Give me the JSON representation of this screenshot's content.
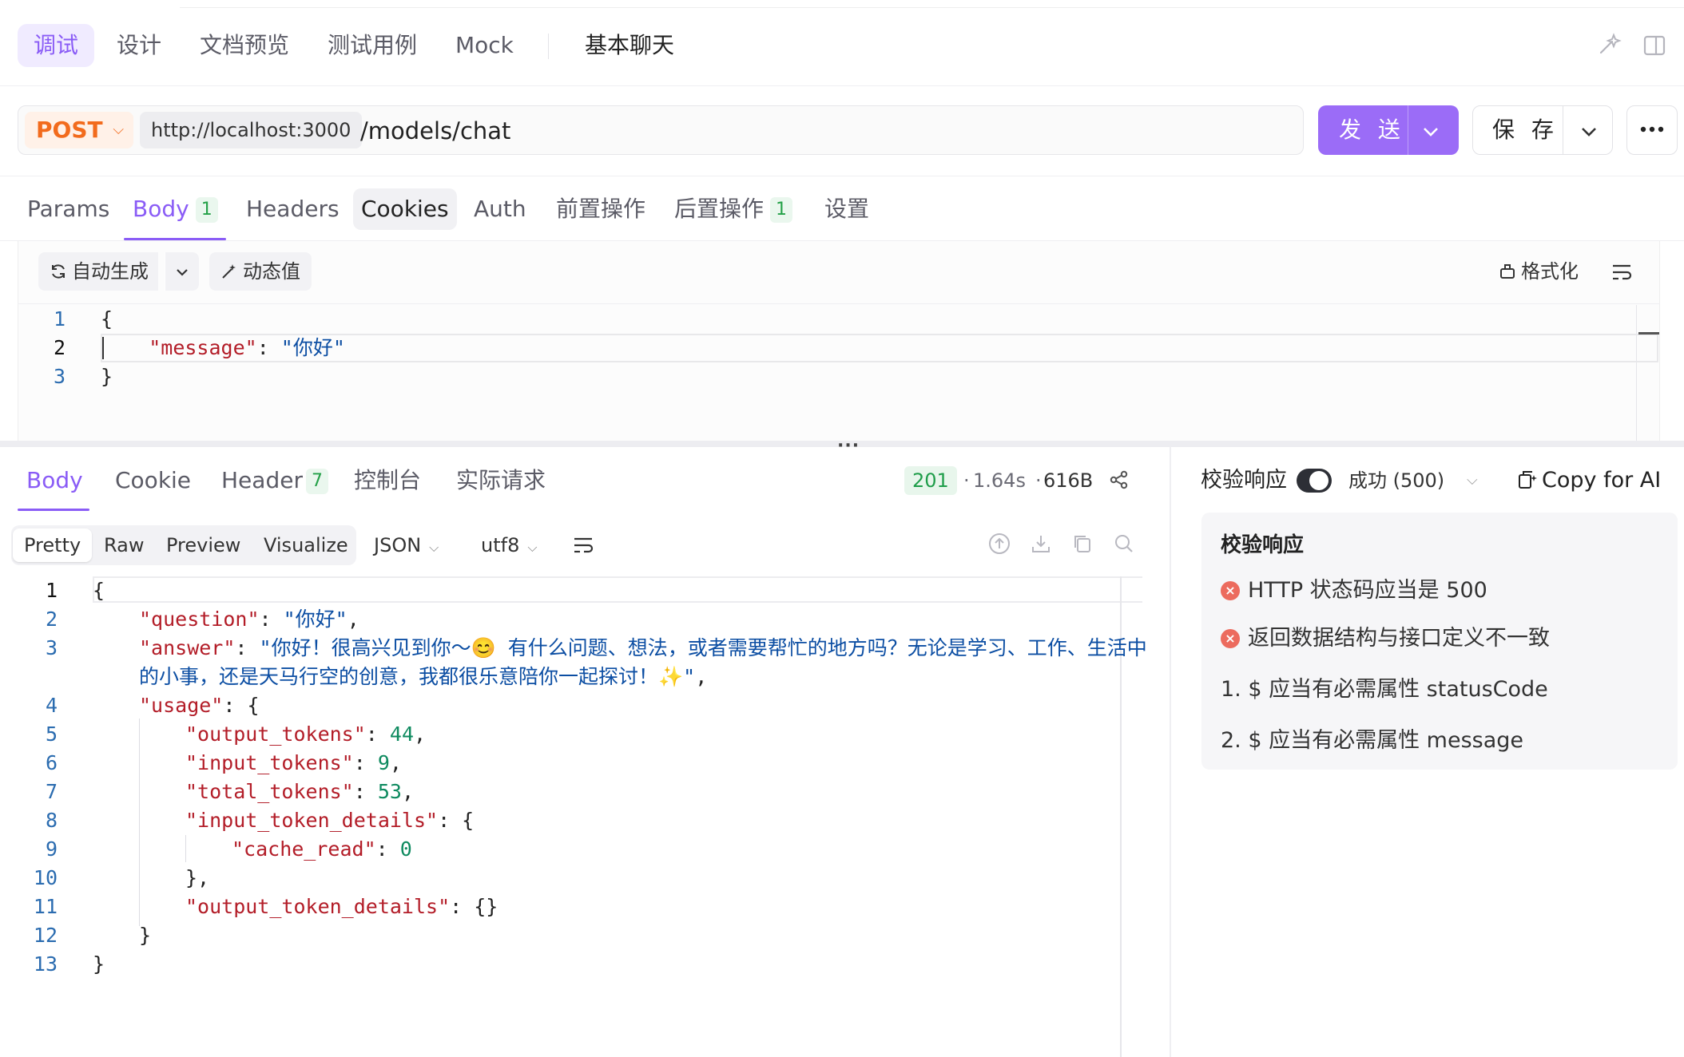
{
  "top_tabs": [
    "调试",
    "设计",
    "文档预览",
    "测试用例",
    "Mock"
  ],
  "api_name": "基本聊天",
  "request": {
    "method": "POST",
    "host": "http://localhost:3000",
    "path": "/models/chat",
    "send_label": "发 送",
    "save_label": "保 存"
  },
  "request_tabs": {
    "params": "Params",
    "body": "Body",
    "body_badge": "1",
    "headers": "Headers",
    "cookies": "Cookies",
    "auth": "Auth",
    "pre": "前置操作",
    "post": "后置操作",
    "post_badge": "1",
    "settings": "设置"
  },
  "body_toolbar": {
    "auto_generate": "自动生成",
    "dynamic_value": "动态值",
    "format": "格式化"
  },
  "request_body_lines": [
    {
      "n": "1",
      "t": "{"
    },
    {
      "n": "2",
      "t": "    \"message\": \"你好\""
    },
    {
      "n": "3",
      "t": "}"
    }
  ],
  "response_tabs": {
    "body": "Body",
    "cookie": "Cookie",
    "header": "Header",
    "header_badge": "7",
    "console": "控制台",
    "actual": "实际请求"
  },
  "response_meta": {
    "status": "201",
    "time": "1.64s",
    "size": "616B"
  },
  "view_tabs": [
    "Pretty",
    "Raw",
    "Preview",
    "Visualize"
  ],
  "format_select": "JSON",
  "encoding_select": "utf8",
  "response_body": {
    "l1": "{",
    "question_key": "\"question\"",
    "question_val": "\"你好\"",
    "answer_key": "\"answer\"",
    "answer_val_1": "\"你好！很高兴见到你～😊 有什么问题、想法，或者需要帮忙的地方吗？无论是学习、工作、生活中",
    "answer_val_2": "的小事，还是天马行空的创意，我都很乐意陪你一起探讨！✨\"",
    "usage_key": "\"usage\"",
    "output_tokens_key": "\"output_tokens\"",
    "output_tokens": "44",
    "input_tokens_key": "\"input_tokens\"",
    "input_tokens": "9",
    "total_tokens_key": "\"total_tokens\"",
    "total_tokens": "53",
    "input_token_details_key": "\"input_token_details\"",
    "cache_read_key": "\"cache_read\"",
    "cache_read": "0",
    "output_token_details_key": "\"output_token_details\"",
    "line_numbers": [
      "1",
      "2",
      "3",
      "4",
      "5",
      "6",
      "7",
      "8",
      "9",
      "10",
      "11",
      "12",
      "13"
    ]
  },
  "validation": {
    "label": "校验响应",
    "select": "成功 (500)",
    "copy_ai": "Copy for AI",
    "panel_title": "校验响应",
    "error_1": "HTTP 状态码应当是 500",
    "error_2": "返回数据结构与接口定义不一致",
    "item_1": "1. $ 应当有必需属性 statusCode",
    "item_2": "2. $ 应当有必需属性 message"
  },
  "colors": {
    "accent": "#8a5cf6",
    "method": "#f26b1d",
    "status_ok": "#1f9d4a",
    "error": "#ec6b5e"
  }
}
